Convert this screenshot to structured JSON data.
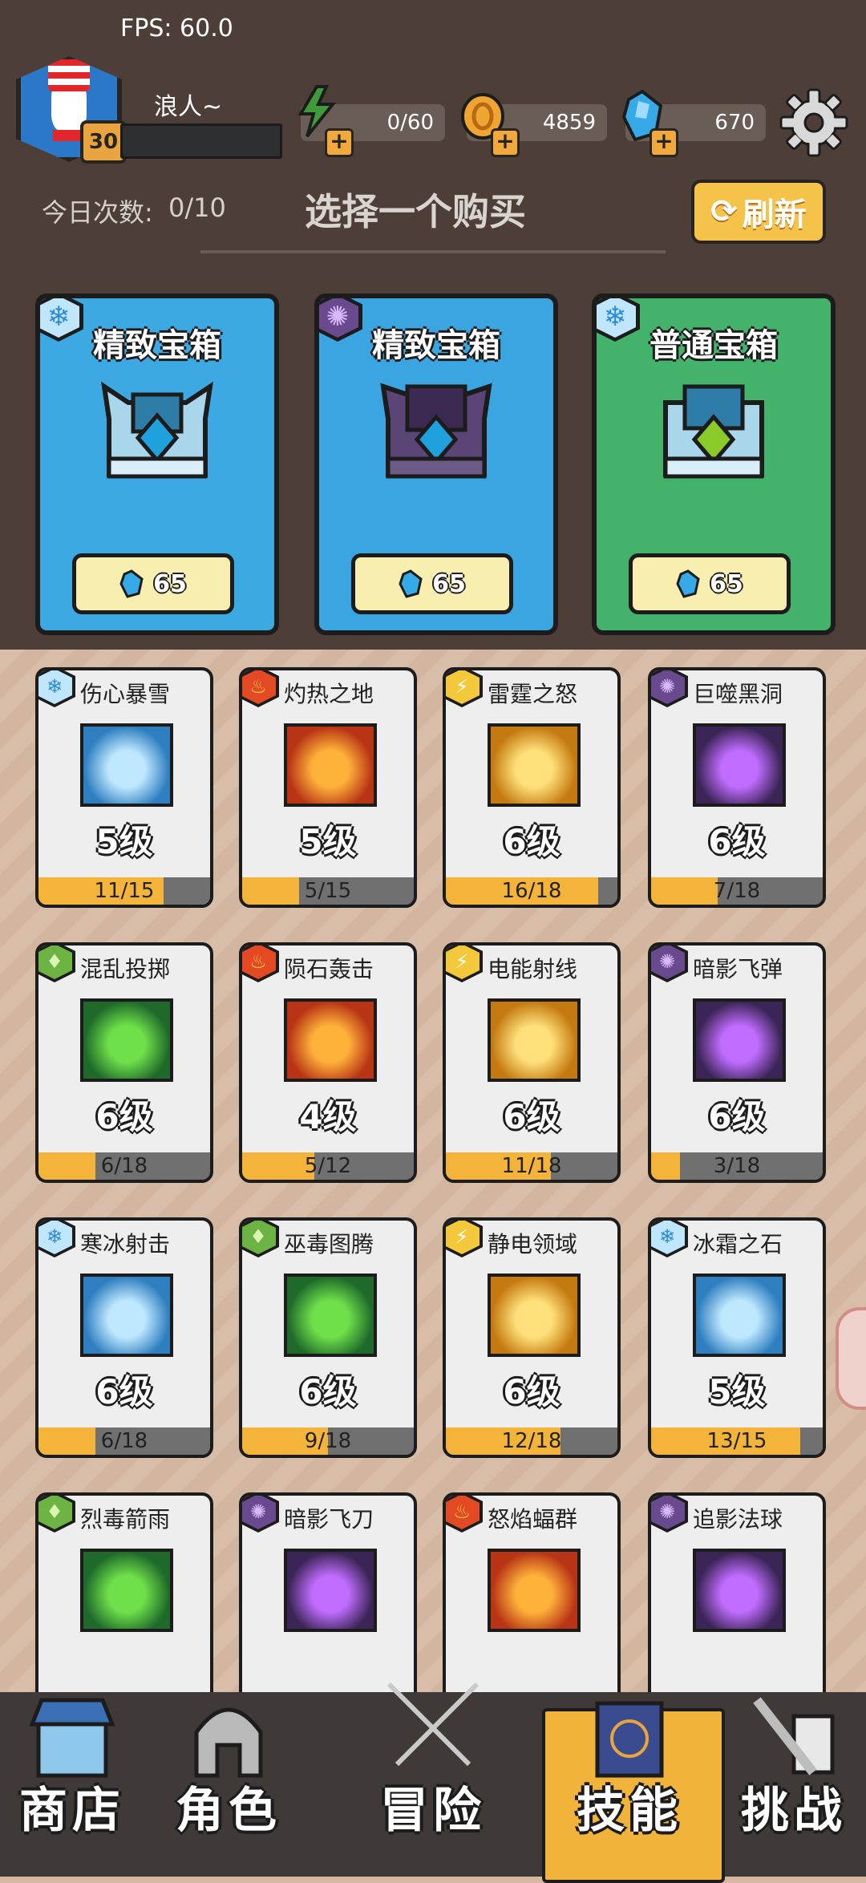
{
  "fps": "FPS: 60.0",
  "player": {
    "name": "浪人~",
    "level": "30"
  },
  "resources": {
    "energy": "0/60",
    "coins": "4859",
    "gems": "670"
  },
  "shop": {
    "daily_label": "今日次数:",
    "daily_value": "0/10",
    "title": "选择一个购买",
    "refresh": "刷新"
  },
  "chests": [
    {
      "name": "精致宝箱",
      "price": "65",
      "element": "ice-icon",
      "color": "#3da9e2"
    },
    {
      "name": "精致宝箱",
      "price": "65",
      "element": "dark-icon",
      "color": "#3ba5e2"
    },
    {
      "name": "普通宝箱",
      "price": "65",
      "element": "ice-icon",
      "color": "#43b36c"
    }
  ],
  "skills": [
    {
      "name": "伤心暴雪",
      "level": "5级",
      "progress": "11/15",
      "fill": 0.73,
      "element": "ice-icon"
    },
    {
      "name": "灼热之地",
      "level": "5级",
      "progress": "5/15",
      "fill": 0.33,
      "element": "fire-icon"
    },
    {
      "name": "雷霆之怒",
      "level": "6级",
      "progress": "16/18",
      "fill": 0.89,
      "element": "lightning-icon"
    },
    {
      "name": "巨噬黑洞",
      "level": "6级",
      "progress": "7/18",
      "fill": 0.39,
      "element": "dark-icon"
    },
    {
      "name": "混乱投掷",
      "level": "6级",
      "progress": "6/18",
      "fill": 0.33,
      "element": "poison-icon"
    },
    {
      "name": "陨石轰击",
      "level": "4级",
      "progress": "5/12",
      "fill": 0.42,
      "element": "fire-icon"
    },
    {
      "name": "电能射线",
      "level": "6级",
      "progress": "11/18",
      "fill": 0.61,
      "element": "lightning-icon"
    },
    {
      "name": "暗影飞弹",
      "level": "6级",
      "progress": "3/18",
      "fill": 0.17,
      "element": "dark-icon"
    },
    {
      "name": "寒冰射击",
      "level": "6级",
      "progress": "6/18",
      "fill": 0.33,
      "element": "ice-icon"
    },
    {
      "name": "巫毒图腾",
      "level": "6级",
      "progress": "9/18",
      "fill": 0.5,
      "element": "poison-icon"
    },
    {
      "name": "静电领域",
      "level": "6级",
      "progress": "12/18",
      "fill": 0.67,
      "element": "lightning-icon"
    },
    {
      "name": "冰霜之石",
      "level": "5级",
      "progress": "13/15",
      "fill": 0.87,
      "element": "ice-icon"
    },
    {
      "name": "烈毒箭雨",
      "level": "",
      "progress": "",
      "fill": 0,
      "element": "poison-icon"
    },
    {
      "name": "暗影飞刀",
      "level": "",
      "progress": "",
      "fill": 0,
      "element": "dark-icon"
    },
    {
      "name": "怒焰蝠群",
      "level": "",
      "progress": "",
      "fill": 0,
      "element": "fire-icon"
    },
    {
      "name": "追影法球",
      "level": "",
      "progress": "",
      "fill": 0,
      "element": "dark-icon"
    }
  ],
  "nav": {
    "shop": "商店",
    "character": "角色",
    "adventure": "冒险",
    "skills": "技能",
    "challenge": "挑战"
  }
}
